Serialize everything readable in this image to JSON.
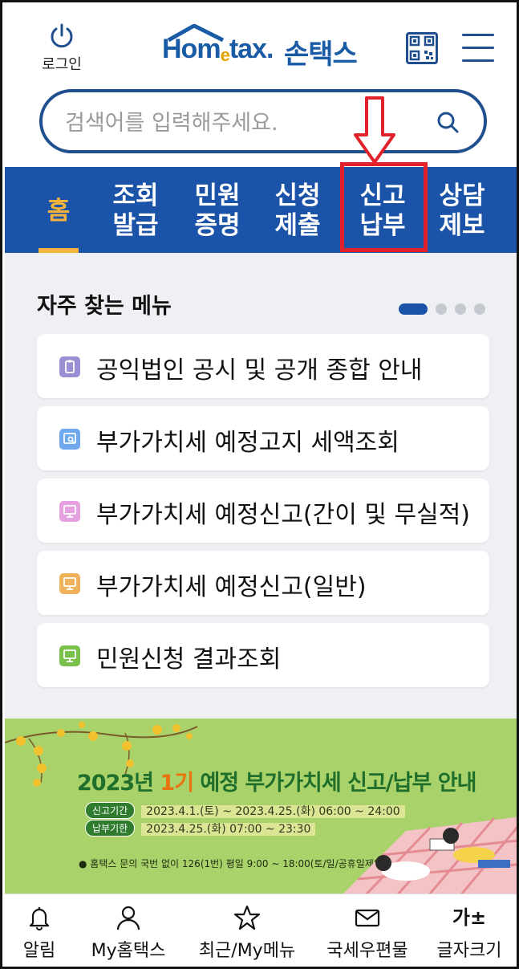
{
  "header": {
    "login_label": "로그인",
    "logo_home": "Hom",
    "logo_e": "e",
    "logo_tax": "tax.",
    "logo_ko": "손택스"
  },
  "search": {
    "placeholder": "검색어를 입력해주세요."
  },
  "nav": {
    "items": [
      {
        "line1": "홈",
        "line2": ""
      },
      {
        "line1": "조회",
        "line2": "발급"
      },
      {
        "line1": "민원",
        "line2": "증명"
      },
      {
        "line1": "신청",
        "line2": "제출"
      },
      {
        "line1": "신고",
        "line2": "납부"
      },
      {
        "line1": "상담",
        "line2": "제보"
      }
    ],
    "active_index": 0
  },
  "frequent": {
    "title": "자주 찾는 메뉴",
    "page_index": 1,
    "page_count": 4,
    "items": [
      {
        "label": "공익법인 공시 및 공개 종합 안내",
        "icon": "clipboard-icon",
        "color": "#9b8fd3"
      },
      {
        "label": "부가가치세 예정고지 세액조회",
        "icon": "search-doc-icon",
        "color": "#6fa8ef"
      },
      {
        "label": "부가가치세 예정신고(간이 및 무실적)",
        "icon": "monitor-icon",
        "color": "#e6a2e0"
      },
      {
        "label": "부가가치세 예정신고(일반)",
        "icon": "monitor-icon",
        "color": "#f0b35c"
      },
      {
        "label": "민원신청 결과조회",
        "icon": "monitor-icon",
        "color": "#7ac14c"
      }
    ]
  },
  "banner": {
    "title_year": "2023년",
    "title_hl": "1기",
    "title_rest": "예정 부가가치세 신고/납부 안내",
    "period_tag": "신고기간",
    "period_val": "2023.4.1.(토) ~ 2023.4.25.(화) 06:00 ~ 24:00",
    "deadline_tag": "납부기한",
    "deadline_val": "2023.4.25.(화) 07:00 ~ 23:30",
    "note": "홈택스 문의 국번 없이 126(1번) 평일 9:00 ~ 18:00(토/일/공휴일제외)"
  },
  "bottom_tabs": [
    {
      "label": "알림",
      "icon": "bell-icon"
    },
    {
      "label": "My홈택스",
      "icon": "person-icon"
    },
    {
      "label": "최근/My메뉴",
      "icon": "star-icon"
    },
    {
      "label": "국세우편물",
      "icon": "envelope-icon"
    },
    {
      "label": "글자크기",
      "icon": "font-size-icon",
      "glyph": "가±"
    }
  ],
  "colors": {
    "brand_blue": "#1b53a8",
    "accent_orange": "#f4b33c",
    "highlight_red": "#e1222a"
  }
}
